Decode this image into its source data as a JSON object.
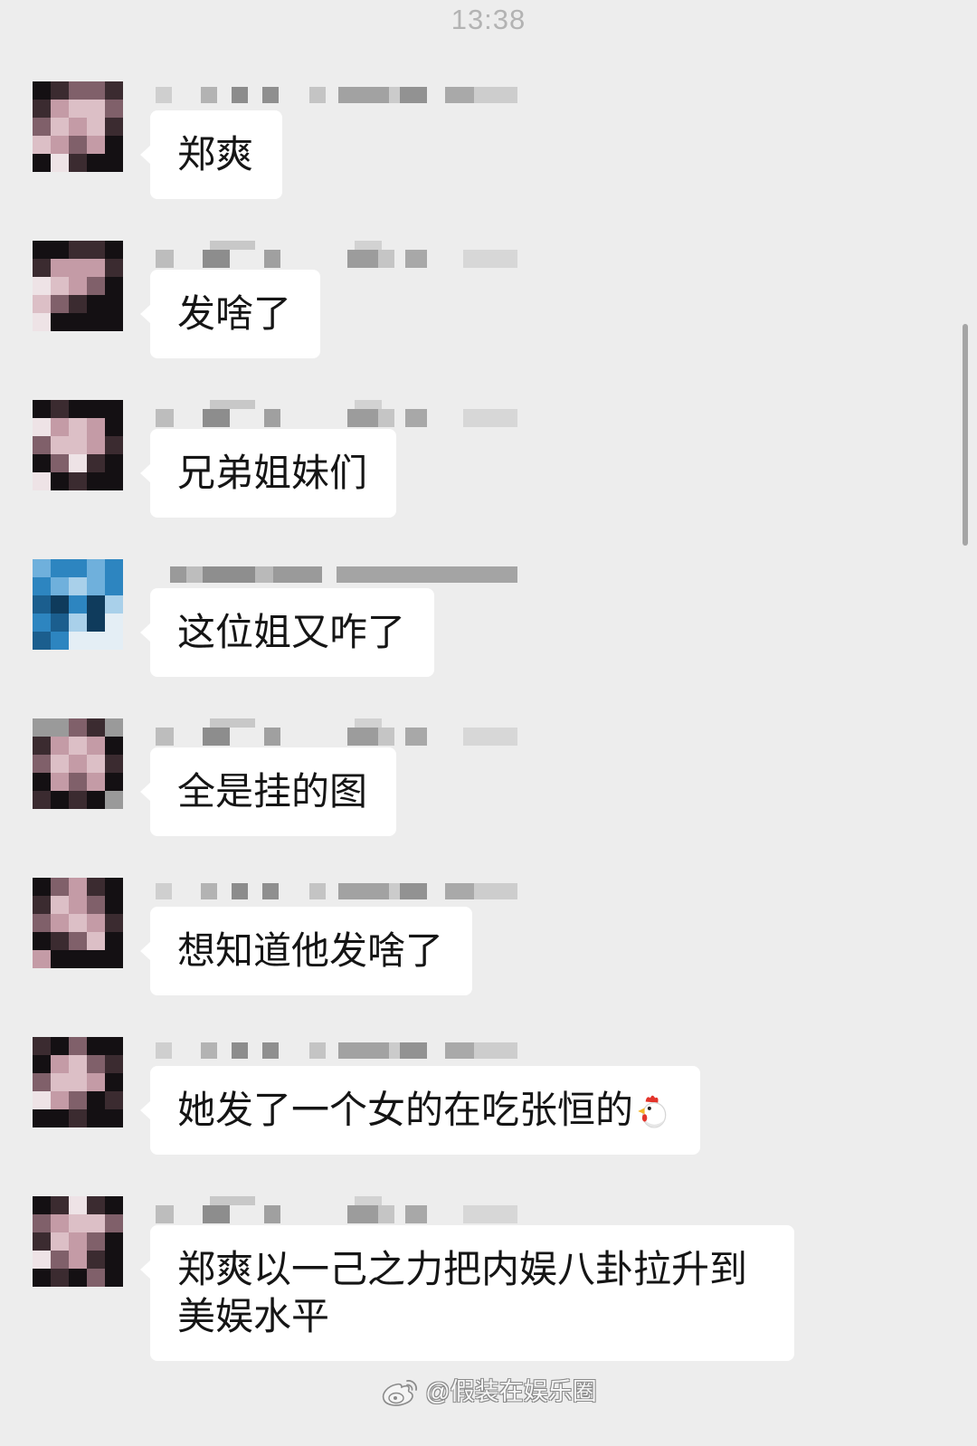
{
  "status": {
    "time": "13:38"
  },
  "messages": [
    {
      "text": "郑爽"
    },
    {
      "text": "发啥了"
    },
    {
      "text": "兄弟姐妹们"
    },
    {
      "text": "这位姐又咋了"
    },
    {
      "text": "全是挂的图"
    },
    {
      "text": "想知道他发啥了"
    },
    {
      "text": "她发了一个女的在吃张恒的",
      "trailing_icon": "chicken-emoji-icon"
    },
    {
      "text": "郑爽以一己之力把内娱八卦拉升到美娱水平"
    }
  ],
  "watermark": {
    "icon": "weibo-logo-icon",
    "text": "@假装在娱乐圈"
  },
  "colors": {
    "background": "#ededed",
    "bubble": "#ffffff",
    "text": "#151515",
    "timestamp": "#b3b3b3"
  }
}
